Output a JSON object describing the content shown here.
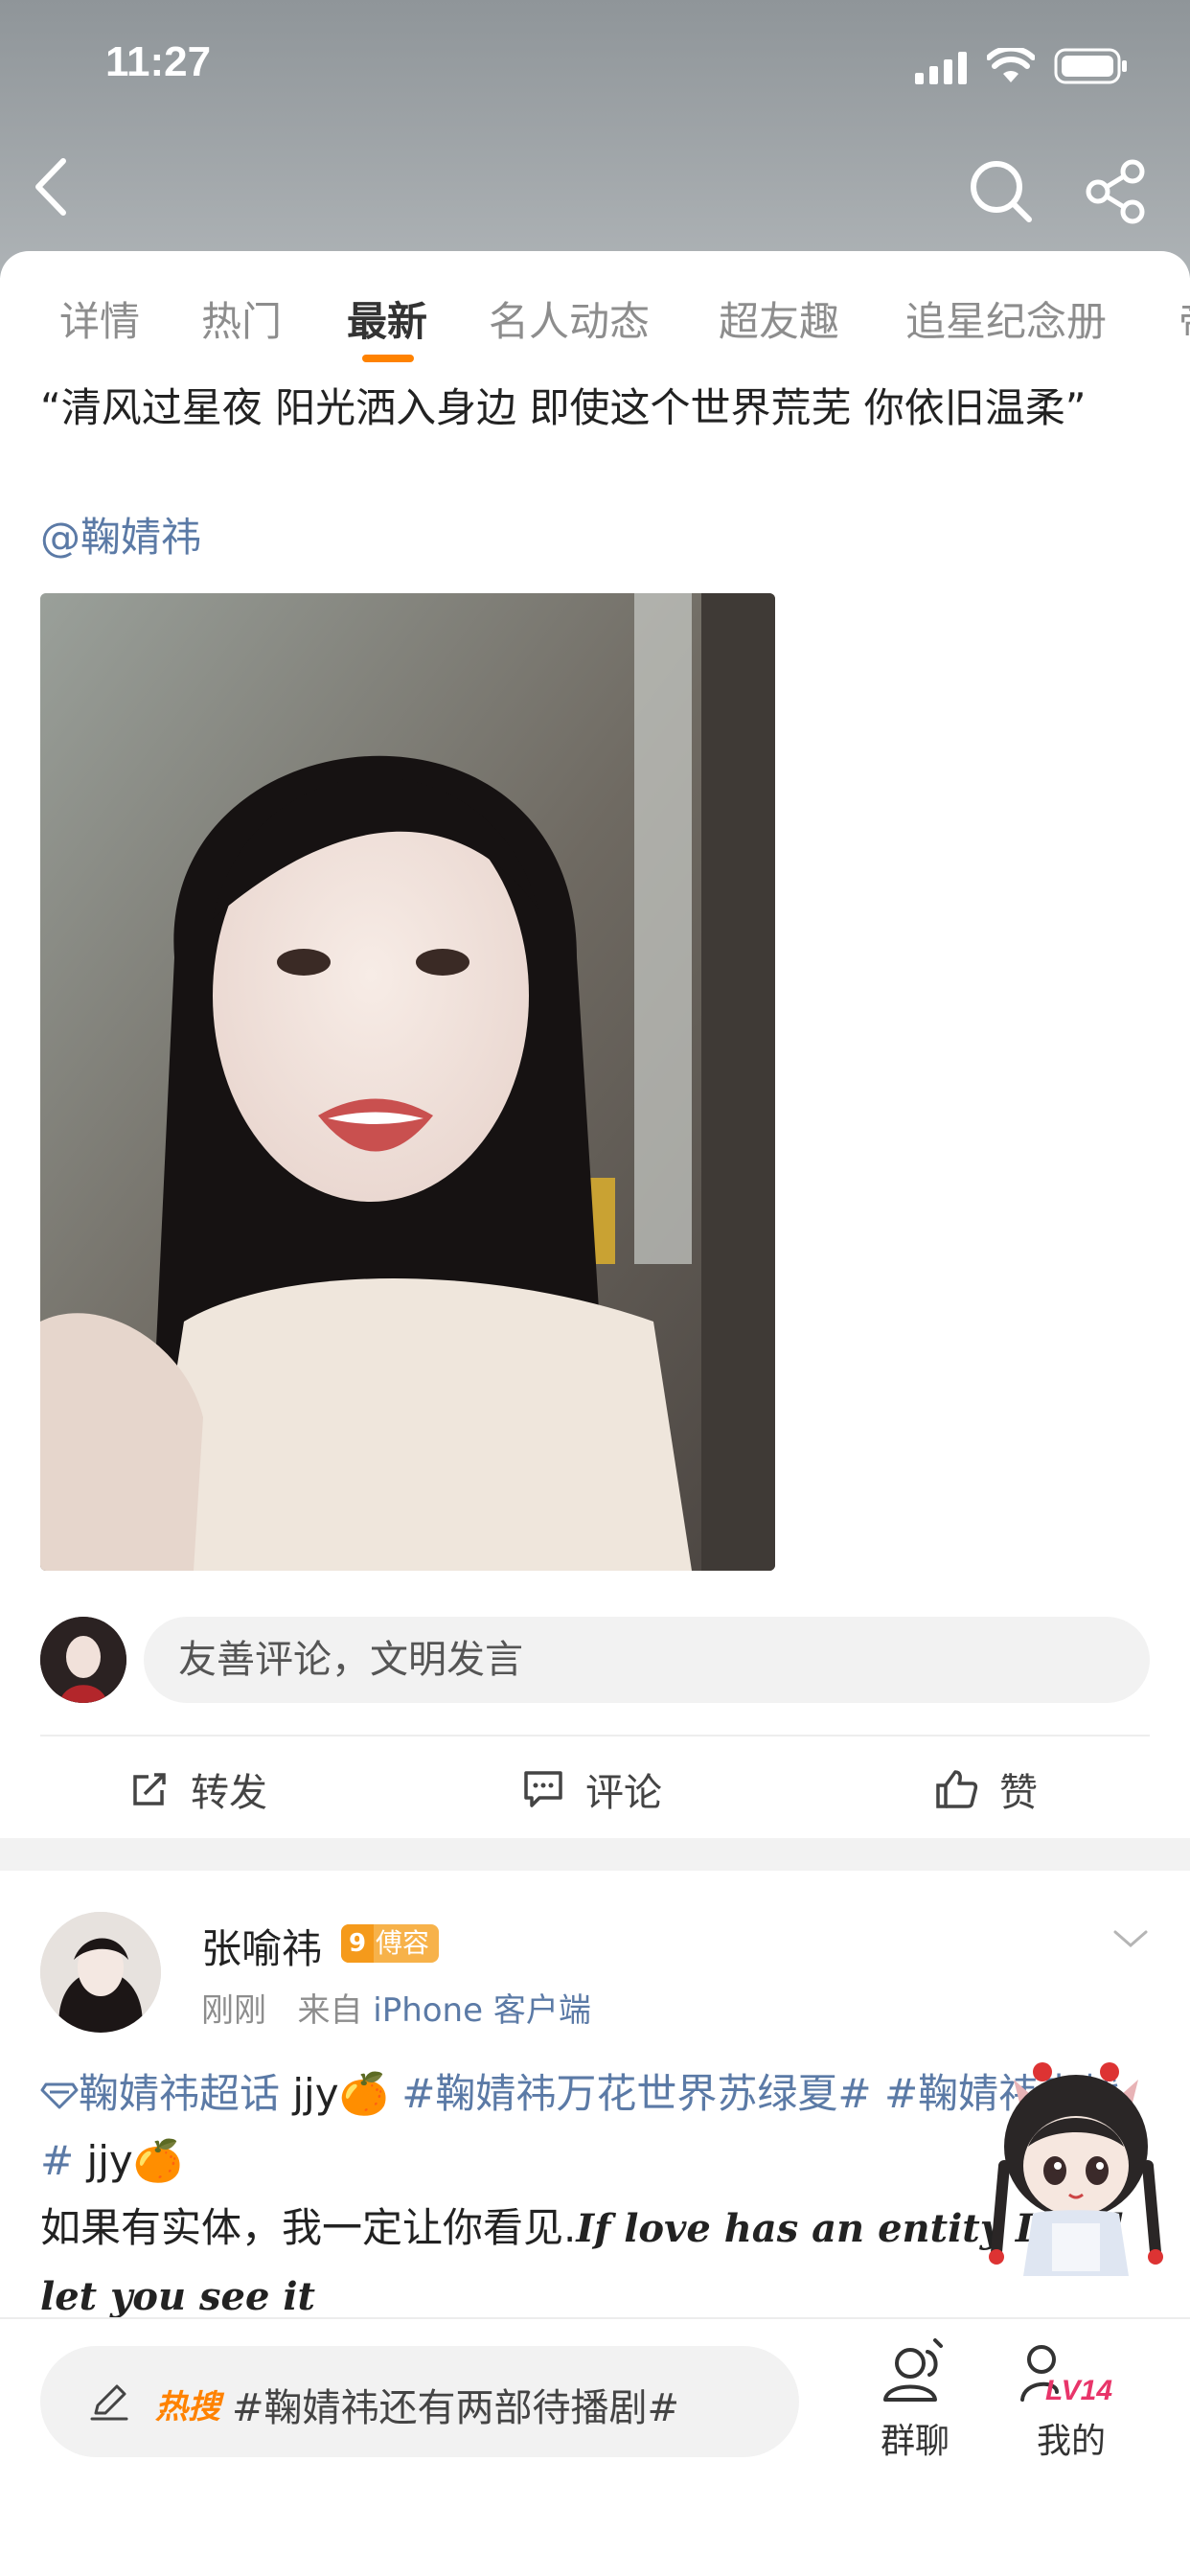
{
  "status_bar": {
    "time": "11:27"
  },
  "tabs": [
    {
      "label": "详情",
      "active": false
    },
    {
      "label": "热门",
      "active": false
    },
    {
      "label": "最新",
      "active": true
    },
    {
      "label": "名人动态",
      "active": false
    },
    {
      "label": "超友趣",
      "active": false
    },
    {
      "label": "追星纪念册",
      "active": false
    },
    {
      "label": "帝",
      "active": false
    }
  ],
  "post1": {
    "text": "“清风过星夜 阳光洒入身边 即使这个世界荒芜 你依旧温柔”",
    "mention": "@鞠婧祎",
    "comment_placeholder": "友善评论，文明发言",
    "actions": {
      "repost": "转发",
      "comment": "评论",
      "like": "赞"
    }
  },
  "post2": {
    "username": "张喻祎",
    "badge_level": "9",
    "badge_label": "傅容",
    "time": "刚刚",
    "source_prefix": "来自",
    "source": "iPhone 客户端",
    "supertopic": "鞠婧祎超话",
    "text1": " jjy🍊 ",
    "hashtag1": "#鞠婧祎万花世界苏绿夏#",
    "text2": " ",
    "hashtag2": "#鞠婧祎来战#",
    "text3": " jjy🍊",
    "line3": "如果有实体，我一定让你看见.",
    "script_text": "If love has an entity  I will let you see it"
  },
  "bottom_bar": {
    "hot_tag": "热搜",
    "hot_text": "#鞠婧祎还有两部待播剧#",
    "group_chat": "群聊",
    "mine": "我的",
    "level": "LV14"
  },
  "colors": {
    "accent": "#ff8200",
    "link": "#5b7aa6",
    "muted": "#8d8d8d"
  }
}
